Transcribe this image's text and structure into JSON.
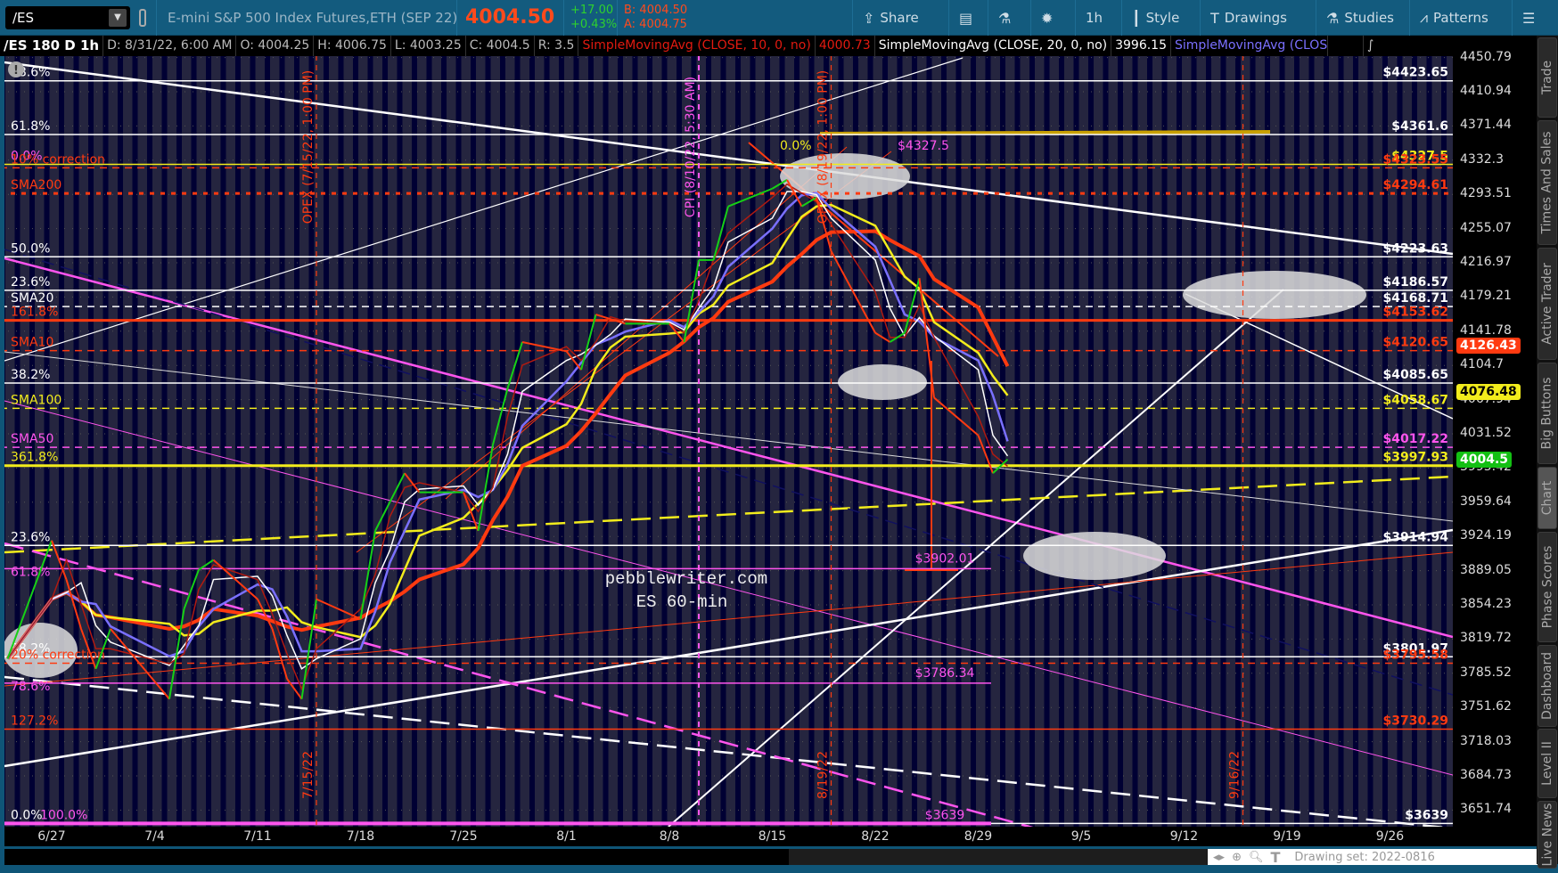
{
  "toolbar": {
    "symbol": "/ES",
    "description": "E-mini S&P 500 Index Futures,ETH (SEP 22)",
    "last": "4004.50",
    "change": "+17.00",
    "change_pct": "+0.43%",
    "bid": "B: 4004.50",
    "ask": "A: 4004.75",
    "buttons": [
      {
        "label": "Share",
        "icon": "share-icon"
      },
      {
        "label": "",
        "icon": "notes-icon"
      },
      {
        "label": "",
        "icon": "flask-icon"
      },
      {
        "label": "",
        "icon": "gear-icon"
      },
      {
        "label": "1h",
        "icon": ""
      },
      {
        "label": "Style",
        "icon": "candles-icon"
      },
      {
        "label": "Drawings",
        "icon": "text-t-icon"
      },
      {
        "label": "Studies",
        "icon": "flask-icon"
      },
      {
        "label": "Patterns",
        "icon": "patterns-icon"
      },
      {
        "label": "",
        "icon": "menu-icon"
      }
    ]
  },
  "infobar": {
    "title": "/ES 180 D 1h",
    "date": "D: 8/31/22, 6:00 AM",
    "open": "O: 4004.25",
    "high": "H: 4006.75",
    "low": "L: 4003.25",
    "close": "C: 4004.5",
    "range": "R: 3.5",
    "sma10_label": "SimpleMovingAvg (CLOSE, 10, 0, no)",
    "sma10_value": "4000.73",
    "sma20_label": "SimpleMovingAvg (CLOSE, 20, 0, no)",
    "sma20_value": "3996.15",
    "sma50_label": "SimpleMovingAvg (CLOSE, 50, 0,..."
  },
  "side_tabs": [
    "Trade",
    "Times And Sales",
    "Active Trader",
    "Big Buttons",
    "Chart",
    "Phase Scores",
    "Dashboard",
    "Level II",
    "Live News"
  ],
  "status": {
    "drawing_set": "Drawing set: 2022-0816"
  },
  "chart_data": {
    "type": "line",
    "title": "ES 60-min",
    "watermark": [
      "pebblewriter.com",
      "ES 60-min"
    ],
    "y_ticks": [
      4450.79,
      4410.94,
      4371.44,
      4332.3,
      4293.51,
      4255.07,
      4216.97,
      4179.21,
      4141.78,
      4104.7,
      4067.94,
      4031.52,
      3995.42,
      3959.64,
      3924.19,
      3889.05,
      3854.23,
      3819.72,
      3785.52,
      3751.62,
      3718.03,
      3684.73,
      3651.74
    ],
    "x_ticks": [
      "6/27",
      "7/4",
      "7/11",
      "7/18",
      "7/25",
      "8/1",
      "8/8",
      "8/15",
      "8/22",
      "8/29",
      "9/5",
      "9/12",
      "9/19",
      "9/26"
    ],
    "price_series": {
      "name": "/ES close (approx)",
      "x": [
        "6/24",
        "6/27",
        "6/28",
        "6/29",
        "6/30",
        "7/1",
        "7/5",
        "7/6",
        "7/7",
        "7/8",
        "7/11",
        "7/12",
        "7/13",
        "7/14",
        "7/15",
        "7/18",
        "7/19",
        "7/20",
        "7/21",
        "7/22",
        "7/25",
        "7/26",
        "7/27",
        "7/28",
        "7/29",
        "8/1",
        "8/2",
        "8/3",
        "8/4",
        "8/5",
        "8/8",
        "8/9",
        "8/10",
        "8/11",
        "8/12",
        "8/15",
        "8/16",
        "8/17",
        "8/18",
        "8/19",
        "8/22",
        "8/23",
        "8/24",
        "8/25",
        "8/26",
        "8/29",
        "8/30",
        "8/31"
      ],
      "y": [
        3800,
        3920,
        3880,
        3830,
        3790,
        3830,
        3760,
        3850,
        3890,
        3900,
        3860,
        3830,
        3780,
        3760,
        3860,
        3840,
        3930,
        3960,
        3990,
        3970,
        3970,
        3930,
        4020,
        4080,
        4130,
        4120,
        4100,
        4160,
        4155,
        4150,
        4150,
        4130,
        4220,
        4220,
        4280,
        4300,
        4310,
        4280,
        4290,
        4230,
        4140,
        4130,
        4140,
        4200,
        4070,
        4030,
        3990,
        4004.5
      ]
    },
    "moving_averages": [
      {
        "name": "SMA10",
        "color": "#b01a10",
        "window": 2
      },
      {
        "name": "SMA20",
        "color": "#ffffff",
        "window": 3
      },
      {
        "name": "SMA50",
        "color": "#7a70ff",
        "window": 4
      },
      {
        "name": "SMA100",
        "color": "#f2ec1c",
        "window": 6
      },
      {
        "name": "SMA200",
        "color": "#ff3a10",
        "window": 9
      }
    ],
    "levels": [
      {
        "price": 4423.65,
        "label": "$4423.65",
        "color": "#ffffff",
        "style": "solid",
        "left": "78.6%",
        "left_color": "#ffffff"
      },
      {
        "price": 4361.6,
        "label": "$4361.6",
        "color": "#ffffff",
        "style": "solid",
        "left": "61.8%",
        "left_color": "#ffffff"
      },
      {
        "price": 4327.5,
        "label": "$4327.5",
        "color": "#f2ec1c",
        "style": "solid",
        "left": "0.0%",
        "left_color": "#ff55ee"
      },
      {
        "price": 4323.55,
        "label": "$4323.55",
        "color": "#ff3a10",
        "style": "dashed",
        "left": "10% correction",
        "left_color": "#ff3a10"
      },
      {
        "price": 4294.61,
        "label": "$4294.61",
        "color": "#ff3a10",
        "style": "dotted",
        "left": "SMA200",
        "left_color": "#ff3a10"
      },
      {
        "price": 4223.63,
        "label": "$4223.63",
        "color": "#ffffff",
        "style": "solid",
        "left": "50.0%",
        "left_color": "#ffffff"
      },
      {
        "price": 4186.57,
        "label": "$4186.57",
        "color": "#ffffff",
        "style": "solid",
        "left": "23.6%",
        "left_color": "#ffffff"
      },
      {
        "price": 4168.71,
        "label": "$4168.71",
        "color": "#ffffff",
        "style": "dashed",
        "left": "SMA20",
        "left_color": "#ffffff"
      },
      {
        "price": 4153.62,
        "label": "$4153.62",
        "color": "#ff3a10",
        "style": "thick",
        "left": "161.8%",
        "left_color": "#ff3a10"
      },
      {
        "price": 4120.65,
        "label": "$4120.65",
        "color": "#ff3a10",
        "style": "dashed",
        "left": "SMA10",
        "left_color": "#ff3a10"
      },
      {
        "price": 4085.65,
        "label": "$4085.65",
        "color": "#ffffff",
        "style": "solid",
        "left": "38.2%",
        "left_color": "#ffffff"
      },
      {
        "price": 4058.67,
        "label": "$4058.67",
        "color": "#f2ec1c",
        "style": "dashed",
        "left": "SMA100",
        "left_color": "#f2ec1c"
      },
      {
        "price": 4017.22,
        "label": "$4017.22",
        "color": "#ff55ee",
        "style": "dashed",
        "left": "SMA50",
        "left_color": "#ff55ee"
      },
      {
        "price": 3997.93,
        "label": "$3997.93",
        "color": "#f2ec1c",
        "style": "thick",
        "left": "361.8%",
        "left_color": "#f2ec1c"
      },
      {
        "price": 3914.94,
        "label": "$3914.94",
        "color": "#ffffff",
        "style": "solid",
        "left": "23.6%",
        "left_color": "#ffffff"
      },
      {
        "price": 3801.97,
        "label": "$3801.97",
        "color": "#ffffff",
        "style": "solid",
        "left": "38.2%",
        "left_color": "#ffffff"
      },
      {
        "price": 3795.58,
        "label": "$3795.58",
        "color": "#ff3a10",
        "style": "dashed",
        "left": "20% correction",
        "left_color": "#ff3a10"
      },
      {
        "price": 3730.29,
        "label": "$3730.29",
        "color": "#ff3a10",
        "style": "solid",
        "left": "127.2%",
        "left_color": "#ff3a10"
      },
      {
        "price": 3639,
        "label": "$3639",
        "color": "#ffffff",
        "style": "solid",
        "left": "0.0%",
        "left_color": "#ffffff"
      }
    ],
    "inner_levels": [
      {
        "price": 3902.01,
        "label": "$3902.01",
        "left": "61.8%"
      },
      {
        "price": 3786.34,
        "label": "$3786.34",
        "left": "78.6%"
      },
      {
        "price": 3639,
        "label": "$3639",
        "left": "100.0%"
      }
    ],
    "annotations": [
      {
        "text": "0.0%",
        "color": "#f2ec1c",
        "date": "8/16",
        "price": 4340
      },
      {
        "text": "$4327.5",
        "color": "#ff55ee",
        "date": "8/24",
        "price": 4340
      }
    ],
    "events": [
      {
        "date": "7/15",
        "label": "OPEX (7/15/22, 1:00 PM)",
        "bottom": "7/15/22",
        "color": "#ff3a10"
      },
      {
        "date": "8/10",
        "label": "CPI (8/10/22, 5:30 AM)",
        "bottom": "",
        "color": "#ff55ee"
      },
      {
        "date": "8/19",
        "label": "OPEX (8/19/22, 1:00 PM)",
        "bottom": "8/19/22",
        "color": "#ff3a10"
      },
      {
        "date": "9/16",
        "label": "",
        "bottom": "9/16/22",
        "color": "#ff3a10"
      }
    ],
    "price_badges": [
      {
        "value": "4126.43",
        "price": 4126.43,
        "color": "#ff3a10",
        "text": "#ffffff"
      },
      {
        "value": "4076.48",
        "price": 4076.48,
        "color": "#f2ec1c",
        "text": "#000000"
      },
      {
        "value": "4004.5",
        "price": 4004.5,
        "color": "#13c013",
        "text": "#ffffff"
      }
    ]
  }
}
